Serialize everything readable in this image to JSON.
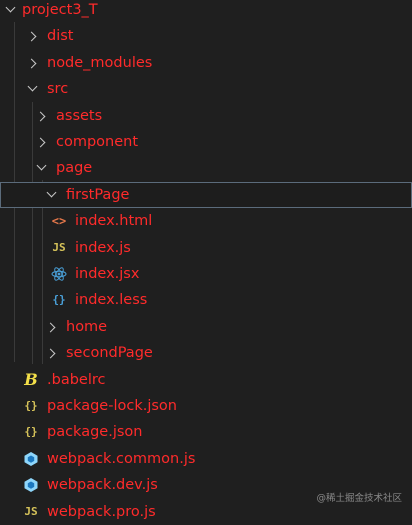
{
  "explorer": {
    "items": [
      {
        "label": "project3_T",
        "kind": "folder-open",
        "icon": "chevron-down-icon"
      },
      {
        "label": "dist",
        "kind": "folder",
        "icon": "chevron-right-icon"
      },
      {
        "label": "node_modules",
        "kind": "folder",
        "icon": "chevron-right-icon"
      },
      {
        "label": "src",
        "kind": "folder-open",
        "icon": "chevron-down-icon"
      },
      {
        "label": "assets",
        "kind": "folder",
        "icon": "chevron-right-icon"
      },
      {
        "label": "component",
        "kind": "folder",
        "icon": "chevron-right-icon"
      },
      {
        "label": "page",
        "kind": "folder-open",
        "icon": "chevron-down-icon"
      },
      {
        "label": "firstPage",
        "kind": "folder-open",
        "icon": "chevron-down-icon",
        "selected": true
      },
      {
        "label": "index.html",
        "kind": "file",
        "icon": "html-file-icon",
        "glyph": "<>"
      },
      {
        "label": "index.js",
        "kind": "file",
        "icon": "javascript-file-icon",
        "glyph": "JS"
      },
      {
        "label": "index.jsx",
        "kind": "file",
        "icon": "react-file-icon"
      },
      {
        "label": "index.less",
        "kind": "file",
        "icon": "less-file-icon",
        "glyph": "{}"
      },
      {
        "label": "home",
        "kind": "folder",
        "icon": "chevron-right-icon"
      },
      {
        "label": "secondPage",
        "kind": "folder",
        "icon": "chevron-right-icon"
      },
      {
        "label": ".babelrc",
        "kind": "file",
        "icon": "babel-file-icon",
        "glyph": "B"
      },
      {
        "label": "package-lock.json",
        "kind": "file",
        "icon": "json-file-icon",
        "glyph": "{}"
      },
      {
        "label": "package.json",
        "kind": "file",
        "icon": "json-file-icon",
        "glyph": "{}"
      },
      {
        "label": "webpack.common.js",
        "kind": "file",
        "icon": "webpack-file-icon"
      },
      {
        "label": "webpack.dev.js",
        "kind": "file",
        "icon": "webpack-file-icon"
      },
      {
        "label": "webpack.pro.js",
        "kind": "file",
        "icon": "javascript-file-icon",
        "glyph": "JS"
      }
    ]
  },
  "watermark": "@稀土掘金技术社区",
  "colors": {
    "label": "#ff2b2b",
    "background": "#1f1f1f",
    "selection_border": "#5b6b7b",
    "js": "#d6c35a",
    "html": "#e4774a",
    "react": "#4aa0d8",
    "webpack": "#8ed6fb",
    "babel": "#f3df49"
  }
}
